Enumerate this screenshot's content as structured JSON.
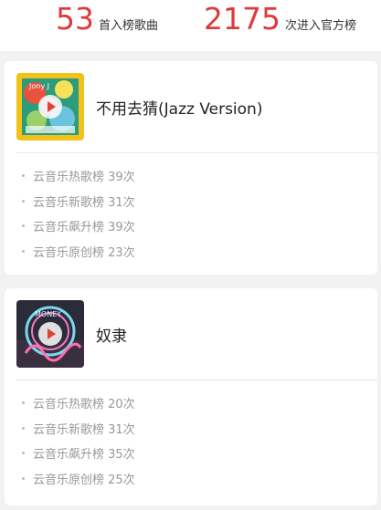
{
  "stats": [
    {
      "number": "53",
      "label": "首入榜歌曲"
    },
    {
      "number": "2175",
      "label": "次进入官方榜"
    }
  ],
  "songs": [
    {
      "title": "不用去猜(Jazz Version)",
      "cover_text": "Jony J",
      "ranks": [
        "云音乐热歌榜 39次",
        "云音乐新歌榜 31次",
        "云音乐飙升榜 39次",
        "云音乐原创榜 23次"
      ]
    },
    {
      "title": "奴隶",
      "cover_text": "MONEY",
      "ranks": [
        "云音乐热歌榜 20次",
        "云音乐新歌榜 31次",
        "云音乐飙升榜 35次",
        "云音乐原创榜 25次"
      ]
    }
  ],
  "colors": {
    "accent": "#dd3a3a",
    "play": "#e0413a",
    "muted": "#999999"
  },
  "icons": {
    "play": "play-icon"
  }
}
